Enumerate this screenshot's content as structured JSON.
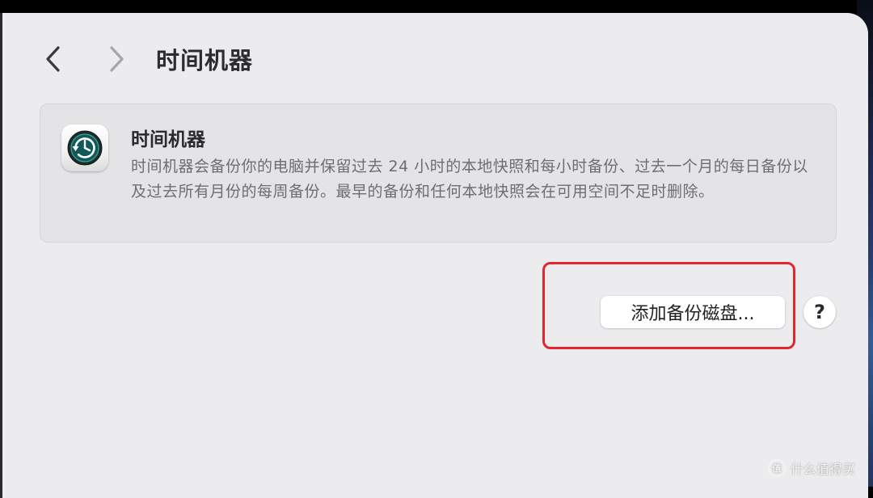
{
  "header": {
    "title": "时间机器"
  },
  "info_card": {
    "app_icon": "time-machine-icon",
    "title": "时间机器",
    "description": "时间机器会备份你的电脑并保留过去 24 小时的本地快照和每小时备份、过去一个月的每日备份以及过去所有月份的每周备份。最早的备份和任何本地快照会在可用空间不足时删除。"
  },
  "actions": {
    "add_disk_label": "添加备份磁盘...",
    "help_label": "?"
  },
  "annotation": {
    "highlight_color": "#e1262d"
  },
  "watermark": {
    "text": "什么值得买"
  }
}
